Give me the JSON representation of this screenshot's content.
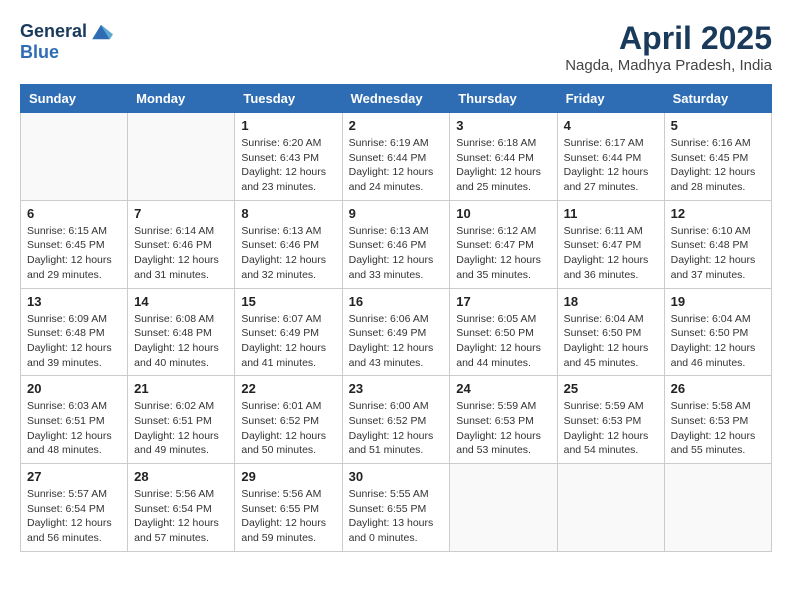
{
  "logo": {
    "line1": "General",
    "line2": "Blue"
  },
  "title": "April 2025",
  "subtitle": "Nagda, Madhya Pradesh, India",
  "weekdays": [
    "Sunday",
    "Monday",
    "Tuesday",
    "Wednesday",
    "Thursday",
    "Friday",
    "Saturday"
  ],
  "weeks": [
    [
      {
        "day": "",
        "info": ""
      },
      {
        "day": "",
        "info": ""
      },
      {
        "day": "1",
        "info": "Sunrise: 6:20 AM\nSunset: 6:43 PM\nDaylight: 12 hours and 23 minutes."
      },
      {
        "day": "2",
        "info": "Sunrise: 6:19 AM\nSunset: 6:44 PM\nDaylight: 12 hours and 24 minutes."
      },
      {
        "day": "3",
        "info": "Sunrise: 6:18 AM\nSunset: 6:44 PM\nDaylight: 12 hours and 25 minutes."
      },
      {
        "day": "4",
        "info": "Sunrise: 6:17 AM\nSunset: 6:44 PM\nDaylight: 12 hours and 27 minutes."
      },
      {
        "day": "5",
        "info": "Sunrise: 6:16 AM\nSunset: 6:45 PM\nDaylight: 12 hours and 28 minutes."
      }
    ],
    [
      {
        "day": "6",
        "info": "Sunrise: 6:15 AM\nSunset: 6:45 PM\nDaylight: 12 hours and 29 minutes."
      },
      {
        "day": "7",
        "info": "Sunrise: 6:14 AM\nSunset: 6:46 PM\nDaylight: 12 hours and 31 minutes."
      },
      {
        "day": "8",
        "info": "Sunrise: 6:13 AM\nSunset: 6:46 PM\nDaylight: 12 hours and 32 minutes."
      },
      {
        "day": "9",
        "info": "Sunrise: 6:13 AM\nSunset: 6:46 PM\nDaylight: 12 hours and 33 minutes."
      },
      {
        "day": "10",
        "info": "Sunrise: 6:12 AM\nSunset: 6:47 PM\nDaylight: 12 hours and 35 minutes."
      },
      {
        "day": "11",
        "info": "Sunrise: 6:11 AM\nSunset: 6:47 PM\nDaylight: 12 hours and 36 minutes."
      },
      {
        "day": "12",
        "info": "Sunrise: 6:10 AM\nSunset: 6:48 PM\nDaylight: 12 hours and 37 minutes."
      }
    ],
    [
      {
        "day": "13",
        "info": "Sunrise: 6:09 AM\nSunset: 6:48 PM\nDaylight: 12 hours and 39 minutes."
      },
      {
        "day": "14",
        "info": "Sunrise: 6:08 AM\nSunset: 6:48 PM\nDaylight: 12 hours and 40 minutes."
      },
      {
        "day": "15",
        "info": "Sunrise: 6:07 AM\nSunset: 6:49 PM\nDaylight: 12 hours and 41 minutes."
      },
      {
        "day": "16",
        "info": "Sunrise: 6:06 AM\nSunset: 6:49 PM\nDaylight: 12 hours and 43 minutes."
      },
      {
        "day": "17",
        "info": "Sunrise: 6:05 AM\nSunset: 6:50 PM\nDaylight: 12 hours and 44 minutes."
      },
      {
        "day": "18",
        "info": "Sunrise: 6:04 AM\nSunset: 6:50 PM\nDaylight: 12 hours and 45 minutes."
      },
      {
        "day": "19",
        "info": "Sunrise: 6:04 AM\nSunset: 6:50 PM\nDaylight: 12 hours and 46 minutes."
      }
    ],
    [
      {
        "day": "20",
        "info": "Sunrise: 6:03 AM\nSunset: 6:51 PM\nDaylight: 12 hours and 48 minutes."
      },
      {
        "day": "21",
        "info": "Sunrise: 6:02 AM\nSunset: 6:51 PM\nDaylight: 12 hours and 49 minutes."
      },
      {
        "day": "22",
        "info": "Sunrise: 6:01 AM\nSunset: 6:52 PM\nDaylight: 12 hours and 50 minutes."
      },
      {
        "day": "23",
        "info": "Sunrise: 6:00 AM\nSunset: 6:52 PM\nDaylight: 12 hours and 51 minutes."
      },
      {
        "day": "24",
        "info": "Sunrise: 5:59 AM\nSunset: 6:53 PM\nDaylight: 12 hours and 53 minutes."
      },
      {
        "day": "25",
        "info": "Sunrise: 5:59 AM\nSunset: 6:53 PM\nDaylight: 12 hours and 54 minutes."
      },
      {
        "day": "26",
        "info": "Sunrise: 5:58 AM\nSunset: 6:53 PM\nDaylight: 12 hours and 55 minutes."
      }
    ],
    [
      {
        "day": "27",
        "info": "Sunrise: 5:57 AM\nSunset: 6:54 PM\nDaylight: 12 hours and 56 minutes."
      },
      {
        "day": "28",
        "info": "Sunrise: 5:56 AM\nSunset: 6:54 PM\nDaylight: 12 hours and 57 minutes."
      },
      {
        "day": "29",
        "info": "Sunrise: 5:56 AM\nSunset: 6:55 PM\nDaylight: 12 hours and 59 minutes."
      },
      {
        "day": "30",
        "info": "Sunrise: 5:55 AM\nSunset: 6:55 PM\nDaylight: 13 hours and 0 minutes."
      },
      {
        "day": "",
        "info": ""
      },
      {
        "day": "",
        "info": ""
      },
      {
        "day": "",
        "info": ""
      }
    ]
  ]
}
